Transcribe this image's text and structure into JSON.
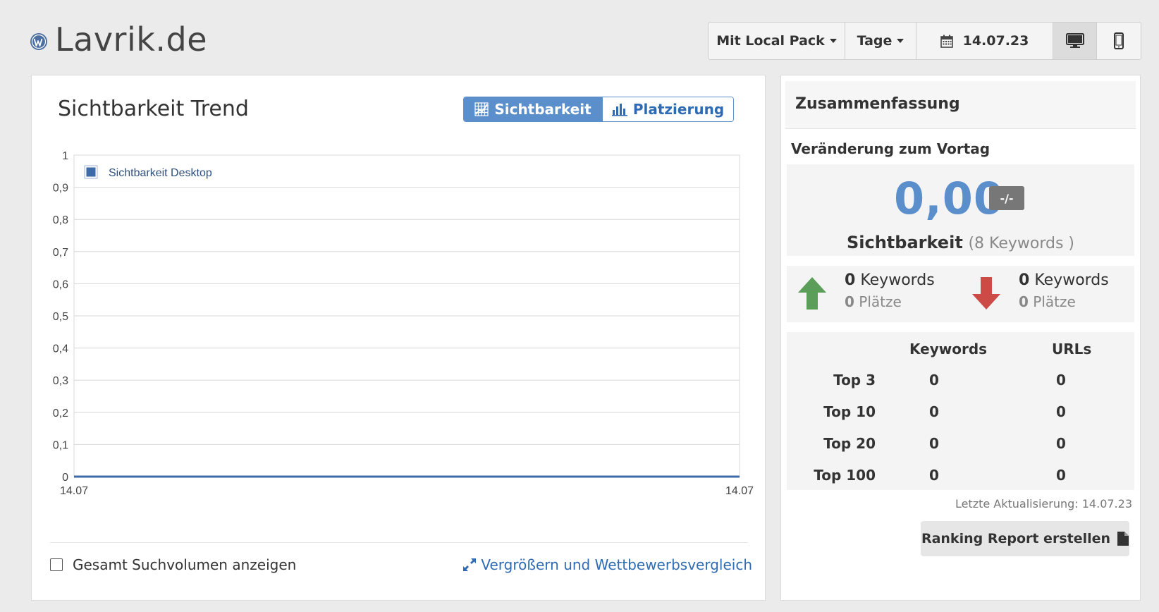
{
  "header": {
    "site_name": "Lavrik.de",
    "site_icon": "wordpress-icon",
    "local_pack_label": "Mit Local Pack",
    "period_label": "Tage",
    "date_label": "14.07.23",
    "device_desktop_icon": "desktop-icon",
    "device_mobile_icon": "mobile-icon"
  },
  "trend_panel": {
    "title": "Sichtbarkeit Trend",
    "tabs": [
      {
        "label": "Sichtbarkeit",
        "icon": "grid-chart-icon",
        "active": true
      },
      {
        "label": "Platzierung",
        "icon": "bar-chart-icon",
        "active": false
      }
    ],
    "show_volume_label": "Gesamt Suchvolumen anzeigen",
    "zoom_link_label": "Vergrößern und Wettbewerbsvergleich"
  },
  "chart_data": {
    "type": "area",
    "x": [
      "14.07",
      "14.07"
    ],
    "series": [
      {
        "name": "Sichtbarkeit Desktop",
        "values": [
          0,
          0
        ],
        "color": "#3d6aa8"
      }
    ],
    "ylim": [
      0,
      1
    ],
    "yticks": [
      "0",
      "0,1",
      "0,2",
      "0,3",
      "0,4",
      "0,5",
      "0,6",
      "0,7",
      "0,8",
      "0,9",
      "1"
    ],
    "grid": true,
    "legend": "top-left"
  },
  "summary": {
    "title": "Zusammenfassung",
    "change_label": "Veränderung zum Vortag",
    "visibility_value": "0,00",
    "visibility_badge": "-/-",
    "visibility_label": "Sichtbarkeit",
    "keywords_count_label": "(8 Keywords )",
    "up": {
      "keywords_value": "0",
      "keywords_label": "Keywords",
      "places_value": "0",
      "places_label": "Plätze",
      "color": "#5a9e5a"
    },
    "down": {
      "keywords_value": "0",
      "keywords_label": "Keywords",
      "places_value": "0",
      "places_label": "Plätze",
      "color": "#cc4b46"
    },
    "table": {
      "headers": [
        "Keywords",
        "URLs"
      ],
      "rows": [
        {
          "label": "Top 3",
          "keywords": "0",
          "urls": "0"
        },
        {
          "label": "Top 10",
          "keywords": "0",
          "urls": "0"
        },
        {
          "label": "Top 20",
          "keywords": "0",
          "urls": "0"
        },
        {
          "label": "Top 100",
          "keywords": "0",
          "urls": "0"
        }
      ]
    },
    "last_update": "Letzte Aktualisierung: 14.07.23",
    "report_button": "Ranking Report erstellen"
  }
}
